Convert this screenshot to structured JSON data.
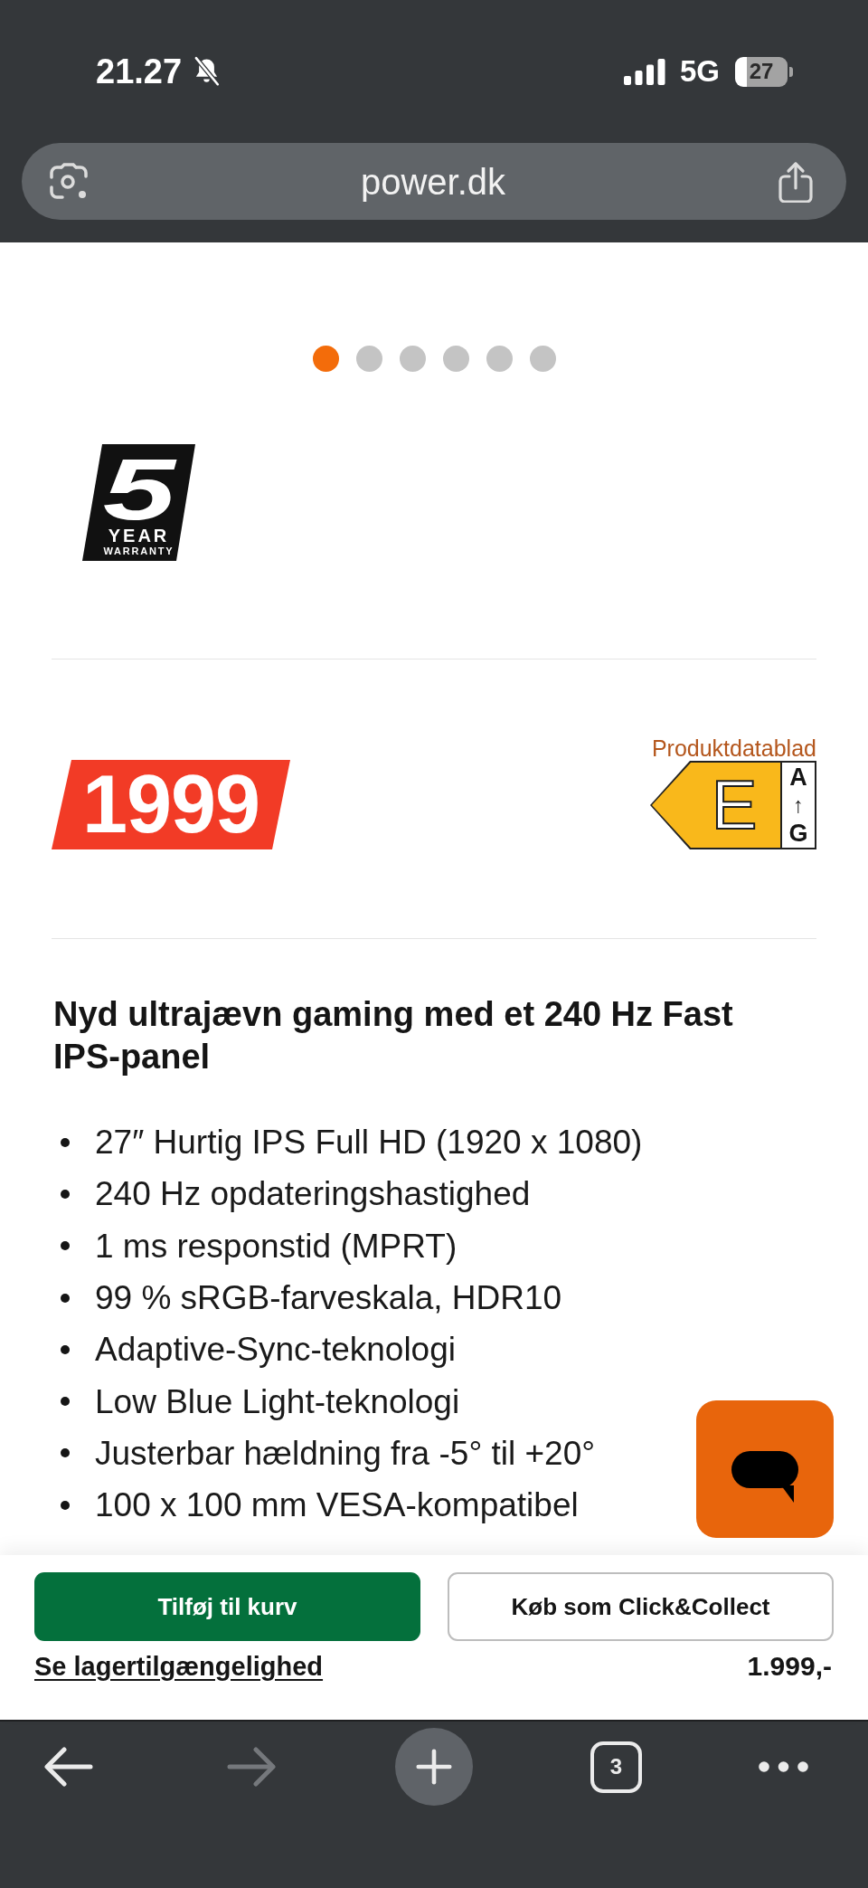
{
  "status_bar": {
    "time": "21.27",
    "silent": true,
    "network": "5G",
    "battery": "27"
  },
  "address_bar": {
    "url": "power.dk"
  },
  "carousel": {
    "dots": [
      {
        "selected": true
      },
      {
        "selected": false
      },
      {
        "selected": false
      },
      {
        "selected": false
      },
      {
        "selected": false
      },
      {
        "selected": false
      }
    ]
  },
  "warranty_badge": {
    "years": "5",
    "line_1": "YEAR",
    "line_2": "WARRANTY"
  },
  "price_tag": "1999",
  "energy_label": {
    "link": "Produktdatablad",
    "class": "E",
    "scale_top": "A",
    "scale_arrow": "↑",
    "scale_bottom": "G"
  },
  "product": {
    "headline": "Nyd ultrajævn gaming med et 240 Hz Fast IPS-panel",
    "features": [
      "27″ Hurtig IPS Full HD (1920 x 1080)",
      "240 Hz opdateringshastighed",
      "1 ms responstid (MPRT)",
      "99 % sRGB-farveskala, HDR10",
      "Adaptive-Sync-teknologi",
      "Low Blue Light-teknologi",
      "Justerbar hældning fra -5° til +20°",
      "100 x 100 mm VESA-kompatibel"
    ]
  },
  "purchase_bar": {
    "buttons": [
      {
        "kind": "primary",
        "label": "Tilføj til kurv"
      },
      {
        "kind": "secondary",
        "label": "Køb som Click&Collect"
      }
    ],
    "stock_link": "Se lagertilgængelighed",
    "price": "1.999,-"
  },
  "browser_toolbar": {
    "items": [
      {
        "kind": "back",
        "disabled": false
      },
      {
        "kind": "forward",
        "disabled": true
      },
      {
        "kind": "new-tab",
        "disabled": false
      },
      {
        "kind": "tabs",
        "label": "3",
        "disabled": false
      },
      {
        "kind": "more",
        "disabled": false
      }
    ]
  }
}
